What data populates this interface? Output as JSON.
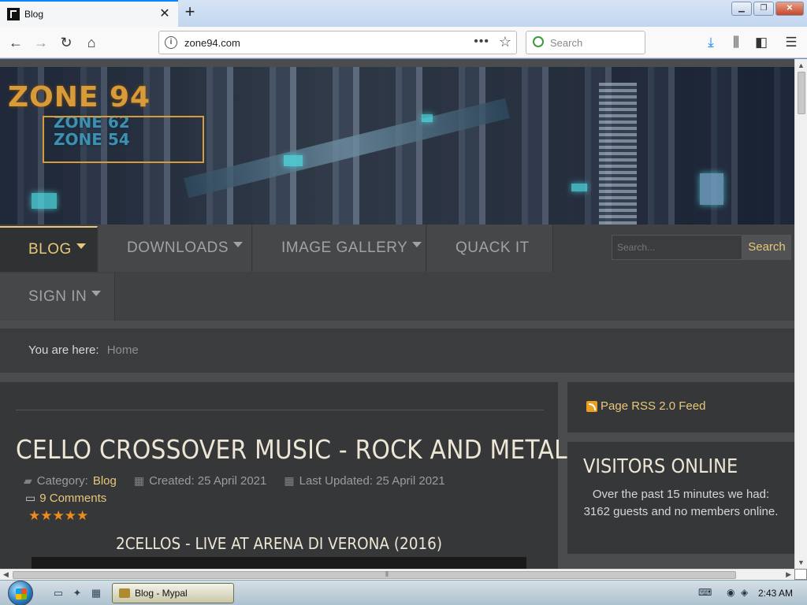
{
  "browser": {
    "tab_title": "Blog",
    "new_tab_label": "+",
    "url": "zone94.com",
    "search_placeholder": "Search",
    "icons": [
      "back-icon",
      "forward-icon",
      "reload-icon",
      "home-icon",
      "info-icon",
      "page-actions-icon",
      "bookmark-star-icon",
      "download-icon",
      "library-icon",
      "sidebar-icon",
      "menu-icon"
    ]
  },
  "site": {
    "logo_main": "ZONE 94",
    "logo_sub1": "ZONE 62",
    "logo_sub2": "ZONE 54",
    "nav": {
      "items": [
        {
          "label": "BLOG",
          "has_caret": true,
          "active": true
        },
        {
          "label": "DOWNLOADS",
          "has_caret": true
        },
        {
          "label": "IMAGE GALLERY",
          "has_caret": true
        },
        {
          "label": "QUACK IT",
          "has_caret": false
        },
        {
          "label": "SIGN IN",
          "has_caret": true
        }
      ],
      "search_placeholder": "Search...",
      "search_button": "Search"
    },
    "breadcrumb": {
      "label": "You are here:",
      "home": "Home"
    },
    "article": {
      "title": "CELLO CROSSOVER MUSIC - ROCK AND METAL",
      "category_label": "Category:",
      "category": "Blog",
      "created": "Created: 25 April 2021",
      "updated": "Last Updated: 25 April 2021",
      "comments": "9 Comments",
      "rating_stars": 5,
      "stars_text": "★★★★★",
      "subtitle": "2CELLOS - LIVE AT ARENA DI VERONA (2016)"
    },
    "sidebar": {
      "rss": "Page RSS 2.0 Feed",
      "visitors_title": "VISITORS ONLINE",
      "visitors_text": "Over the past 15 minutes we had: 3162 guests and no members online."
    },
    "colors": {
      "accent": "#e8c87a",
      "star": "#f08a1c",
      "page_bg": "#4a4c4e"
    }
  },
  "taskbar": {
    "task_label": "Blog - Mypal",
    "clock": "2:43 AM"
  }
}
